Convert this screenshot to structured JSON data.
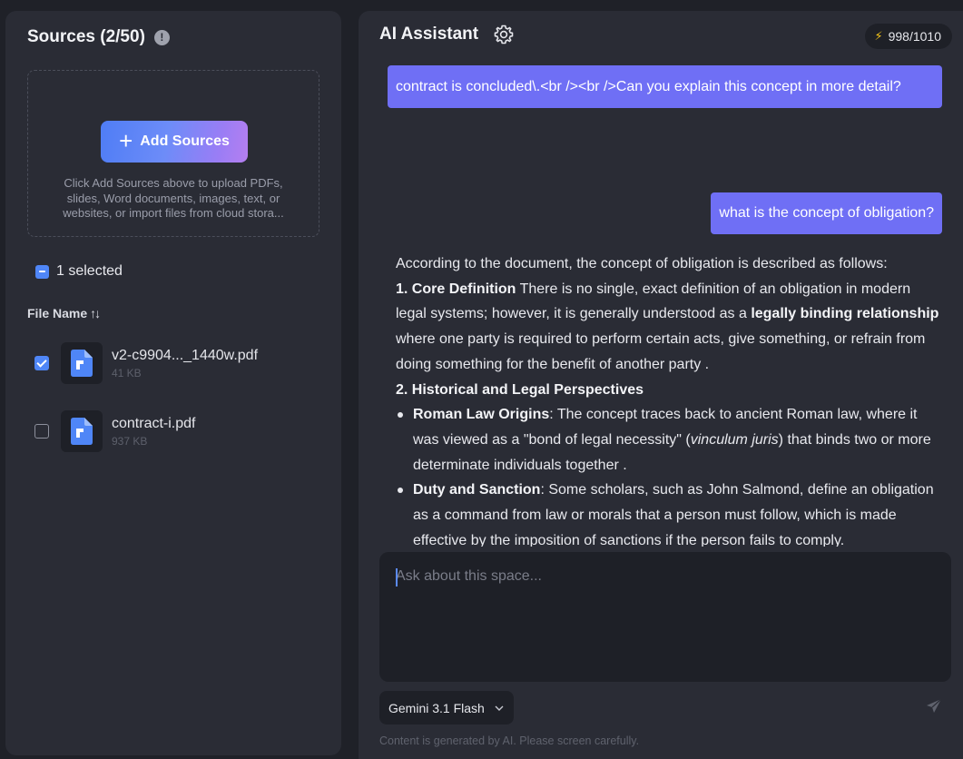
{
  "sources": {
    "title": "Sources (2/50)",
    "info_icon": "!",
    "add_button_label": "Add Sources",
    "hint": "Click Add Sources above to upload PDFs, slides, Word documents, images, text, or websites, or import files from cloud stora...",
    "selected_label": "1 selected",
    "column_header": "File Name",
    "sort_icon": "↑↓",
    "files": [
      {
        "name": "v2-c9904..._1440w.pdf",
        "size": "41 KB",
        "checked": true
      },
      {
        "name": "contract-i.pdf",
        "size": "937 KB",
        "checked": false
      }
    ]
  },
  "assistant": {
    "title": "AI Assistant",
    "credits": "998/1010",
    "messages": {
      "user_1": "contract is concluded\\.<br /><br />Can you explain this concept in more detail?",
      "user_2": "what is the concept of obligation?",
      "reply": {
        "intro": "According to the document, the concept of obligation is described as follows:",
        "h1": "1. Core Definition",
        "p1_a": " There is no single, exact definition of an obligation in modern legal systems; however, it is generally understood as a ",
        "p1_b": "legally binding relationship",
        "p1_c": " where one party is required to perform certain acts, give something, or refrain from doing something for the benefit of another party .",
        "h2": "2. Historical and Legal Perspectives",
        "b1_title": "Roman Law Origins",
        "b1_a": ": The concept traces back to ancient Roman law, where it was viewed as a \"bond of legal necessity\" (",
        "b1_i": "vinculum juris",
        "b1_b": ") that binds two or more determinate individuals together .",
        "b2_title": "Duty and Sanction",
        "b2_a": ": Some scholars, such as John Salmond, define an obligation as a command from law or morals that a person must follow, which is made effective by the imposition of sanctions if the person fails to comply."
      }
    },
    "input_placeholder": "Ask about this space...",
    "model": "Gemini 3.1 Flash",
    "disclaimer": "Content is generated by AI. Please screen carefully."
  },
  "colors": {
    "background": "#1f2128",
    "panel": "#2a2c35",
    "user_bubble": "#6f6ff5",
    "accent_blue": "#4f86f7",
    "bolt": "#f5c518"
  },
  "icons": [
    "info-icon",
    "plus-icon",
    "checkbox-partial-icon",
    "sort-icon",
    "checkbox-checked-icon",
    "checkbox-unchecked-icon",
    "document-icon",
    "gear-icon",
    "bolt-icon",
    "chevron-down-icon",
    "send-icon"
  ]
}
